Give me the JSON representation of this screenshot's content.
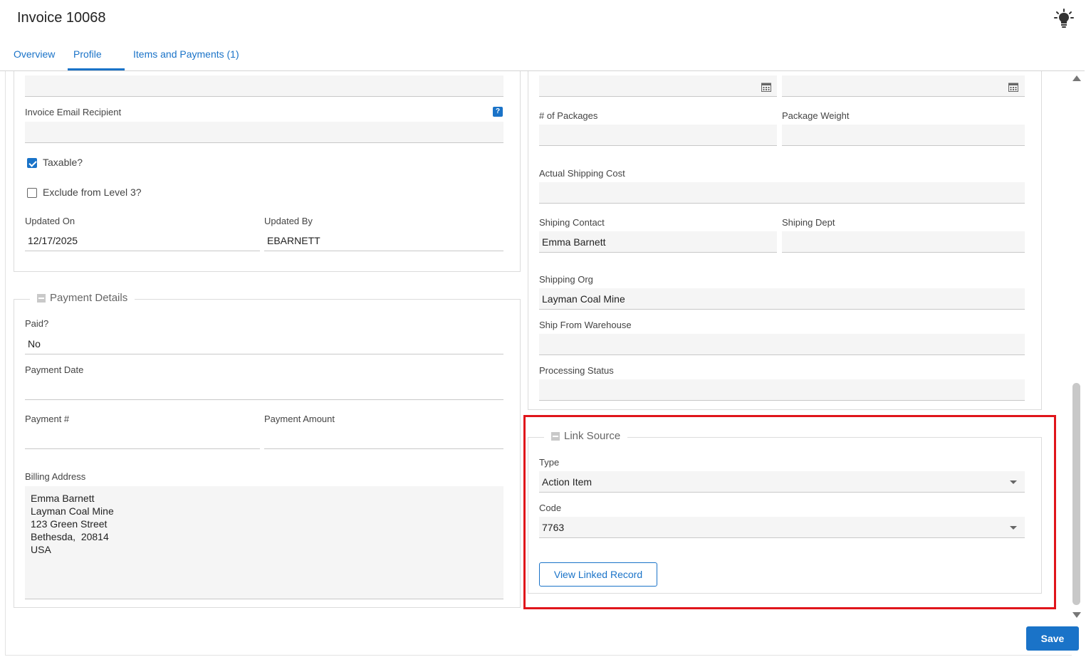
{
  "header": {
    "title": "Invoice 10068"
  },
  "tabs": [
    {
      "label": "Overview"
    },
    {
      "label": "Profile",
      "active": true
    },
    {
      "label": "Items and Payments (1)"
    }
  ],
  "left": {
    "invoice_email_label": "Invoice Email Recipient",
    "taxable_label": "Taxable?",
    "taxable_checked": true,
    "exclude_label": "Exclude from Level 3?",
    "exclude_checked": false,
    "updated_on_label": "Updated On",
    "updated_on_value": "12/17/2025",
    "updated_by_label": "Updated By",
    "updated_by_value": "EBARNETT"
  },
  "payment": {
    "legend": "Payment Details",
    "paid_label": "Paid?",
    "paid_value": "No",
    "payment_date_label": "Payment Date",
    "payment_num_label": "Payment #",
    "payment_amount_label": "Payment Amount",
    "billing_label": "Billing Address",
    "billing_lines": [
      "Emma Barnett",
      "Layman Coal Mine",
      "123 Green Street",
      "Bethesda,  20814",
      "USA"
    ]
  },
  "shipping": {
    "packages_label": "# of Packages",
    "weight_label": "Package Weight",
    "actual_cost_label": "Actual Shipping Cost",
    "contact_label": "Shiping Contact",
    "contact_value": "Emma Barnett",
    "dept_label": "Shiping Dept",
    "org_label": "Shipping Org",
    "org_value": "Layman Coal Mine",
    "warehouse_label": "Ship From Warehouse",
    "status_label": "Processing Status"
  },
  "link_source": {
    "legend": "Link Source",
    "type_label": "Type",
    "type_value": "Action Item",
    "code_label": "Code",
    "code_value": "7763",
    "view_button": "View Linked Record"
  },
  "footer": {
    "save_label": "Save"
  },
  "colors": {
    "accent": "#1a73c8",
    "highlight": "#e0151b"
  }
}
